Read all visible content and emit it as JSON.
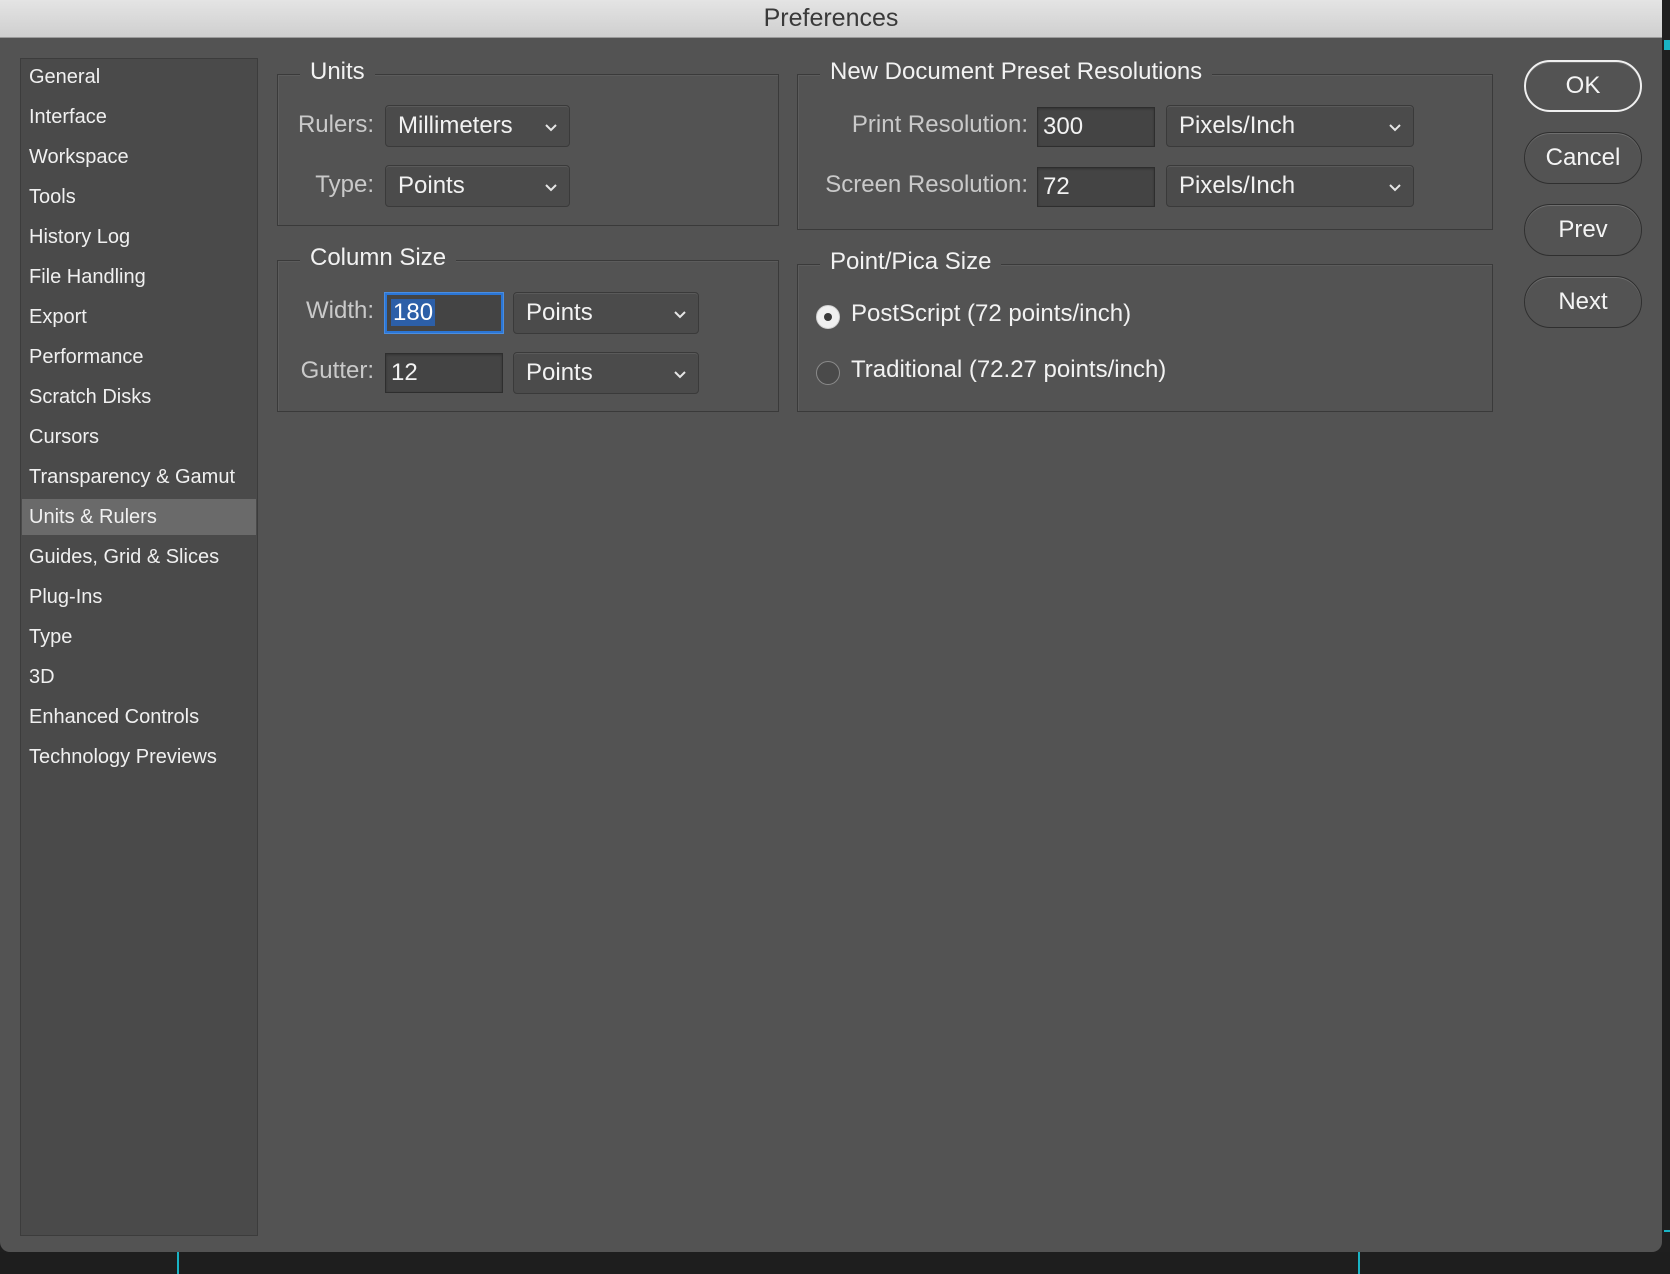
{
  "window": {
    "title": "Preferences"
  },
  "sidebar": {
    "selected_index": 11,
    "items": [
      {
        "label": "General"
      },
      {
        "label": "Interface"
      },
      {
        "label": "Workspace"
      },
      {
        "label": "Tools"
      },
      {
        "label": "History Log"
      },
      {
        "label": "File Handling"
      },
      {
        "label": "Export"
      },
      {
        "label": "Performance"
      },
      {
        "label": "Scratch Disks"
      },
      {
        "label": "Cursors"
      },
      {
        "label": "Transparency & Gamut"
      },
      {
        "label": "Units & Rulers"
      },
      {
        "label": "Guides, Grid & Slices"
      },
      {
        "label": "Plug-Ins"
      },
      {
        "label": "Type"
      },
      {
        "label": "3D"
      },
      {
        "label": "Enhanced Controls"
      },
      {
        "label": "Technology Previews"
      }
    ]
  },
  "units": {
    "title": "Units",
    "rulers_label": "Rulers:",
    "rulers_value": "Millimeters",
    "type_label": "Type:",
    "type_value": "Points"
  },
  "column_size": {
    "title": "Column Size",
    "width_label": "Width:",
    "width_value": "180",
    "width_unit": "Points",
    "gutter_label": "Gutter:",
    "gutter_value": "12",
    "gutter_unit": "Points"
  },
  "new_doc": {
    "title": "New Document Preset Resolutions",
    "print_label": "Print Resolution:",
    "print_value": "300",
    "print_unit": "Pixels/Inch",
    "screen_label": "Screen Resolution:",
    "screen_value": "72",
    "screen_unit": "Pixels/Inch"
  },
  "point_pica": {
    "title": "Point/Pica Size",
    "postscript_label": "PostScript (72 points/inch)",
    "postscript_selected": true,
    "traditional_label": "Traditional (72.27 points/inch)",
    "traditional_selected": false
  },
  "buttons": {
    "ok": "OK",
    "cancel": "Cancel",
    "prev": "Prev",
    "next": "Next"
  },
  "colors": {
    "panel_bg": "#535353",
    "selected_item_bg": "#6a6a6a",
    "focus_ring": "#2b76d6",
    "guide_lines": "#19b3c4"
  }
}
